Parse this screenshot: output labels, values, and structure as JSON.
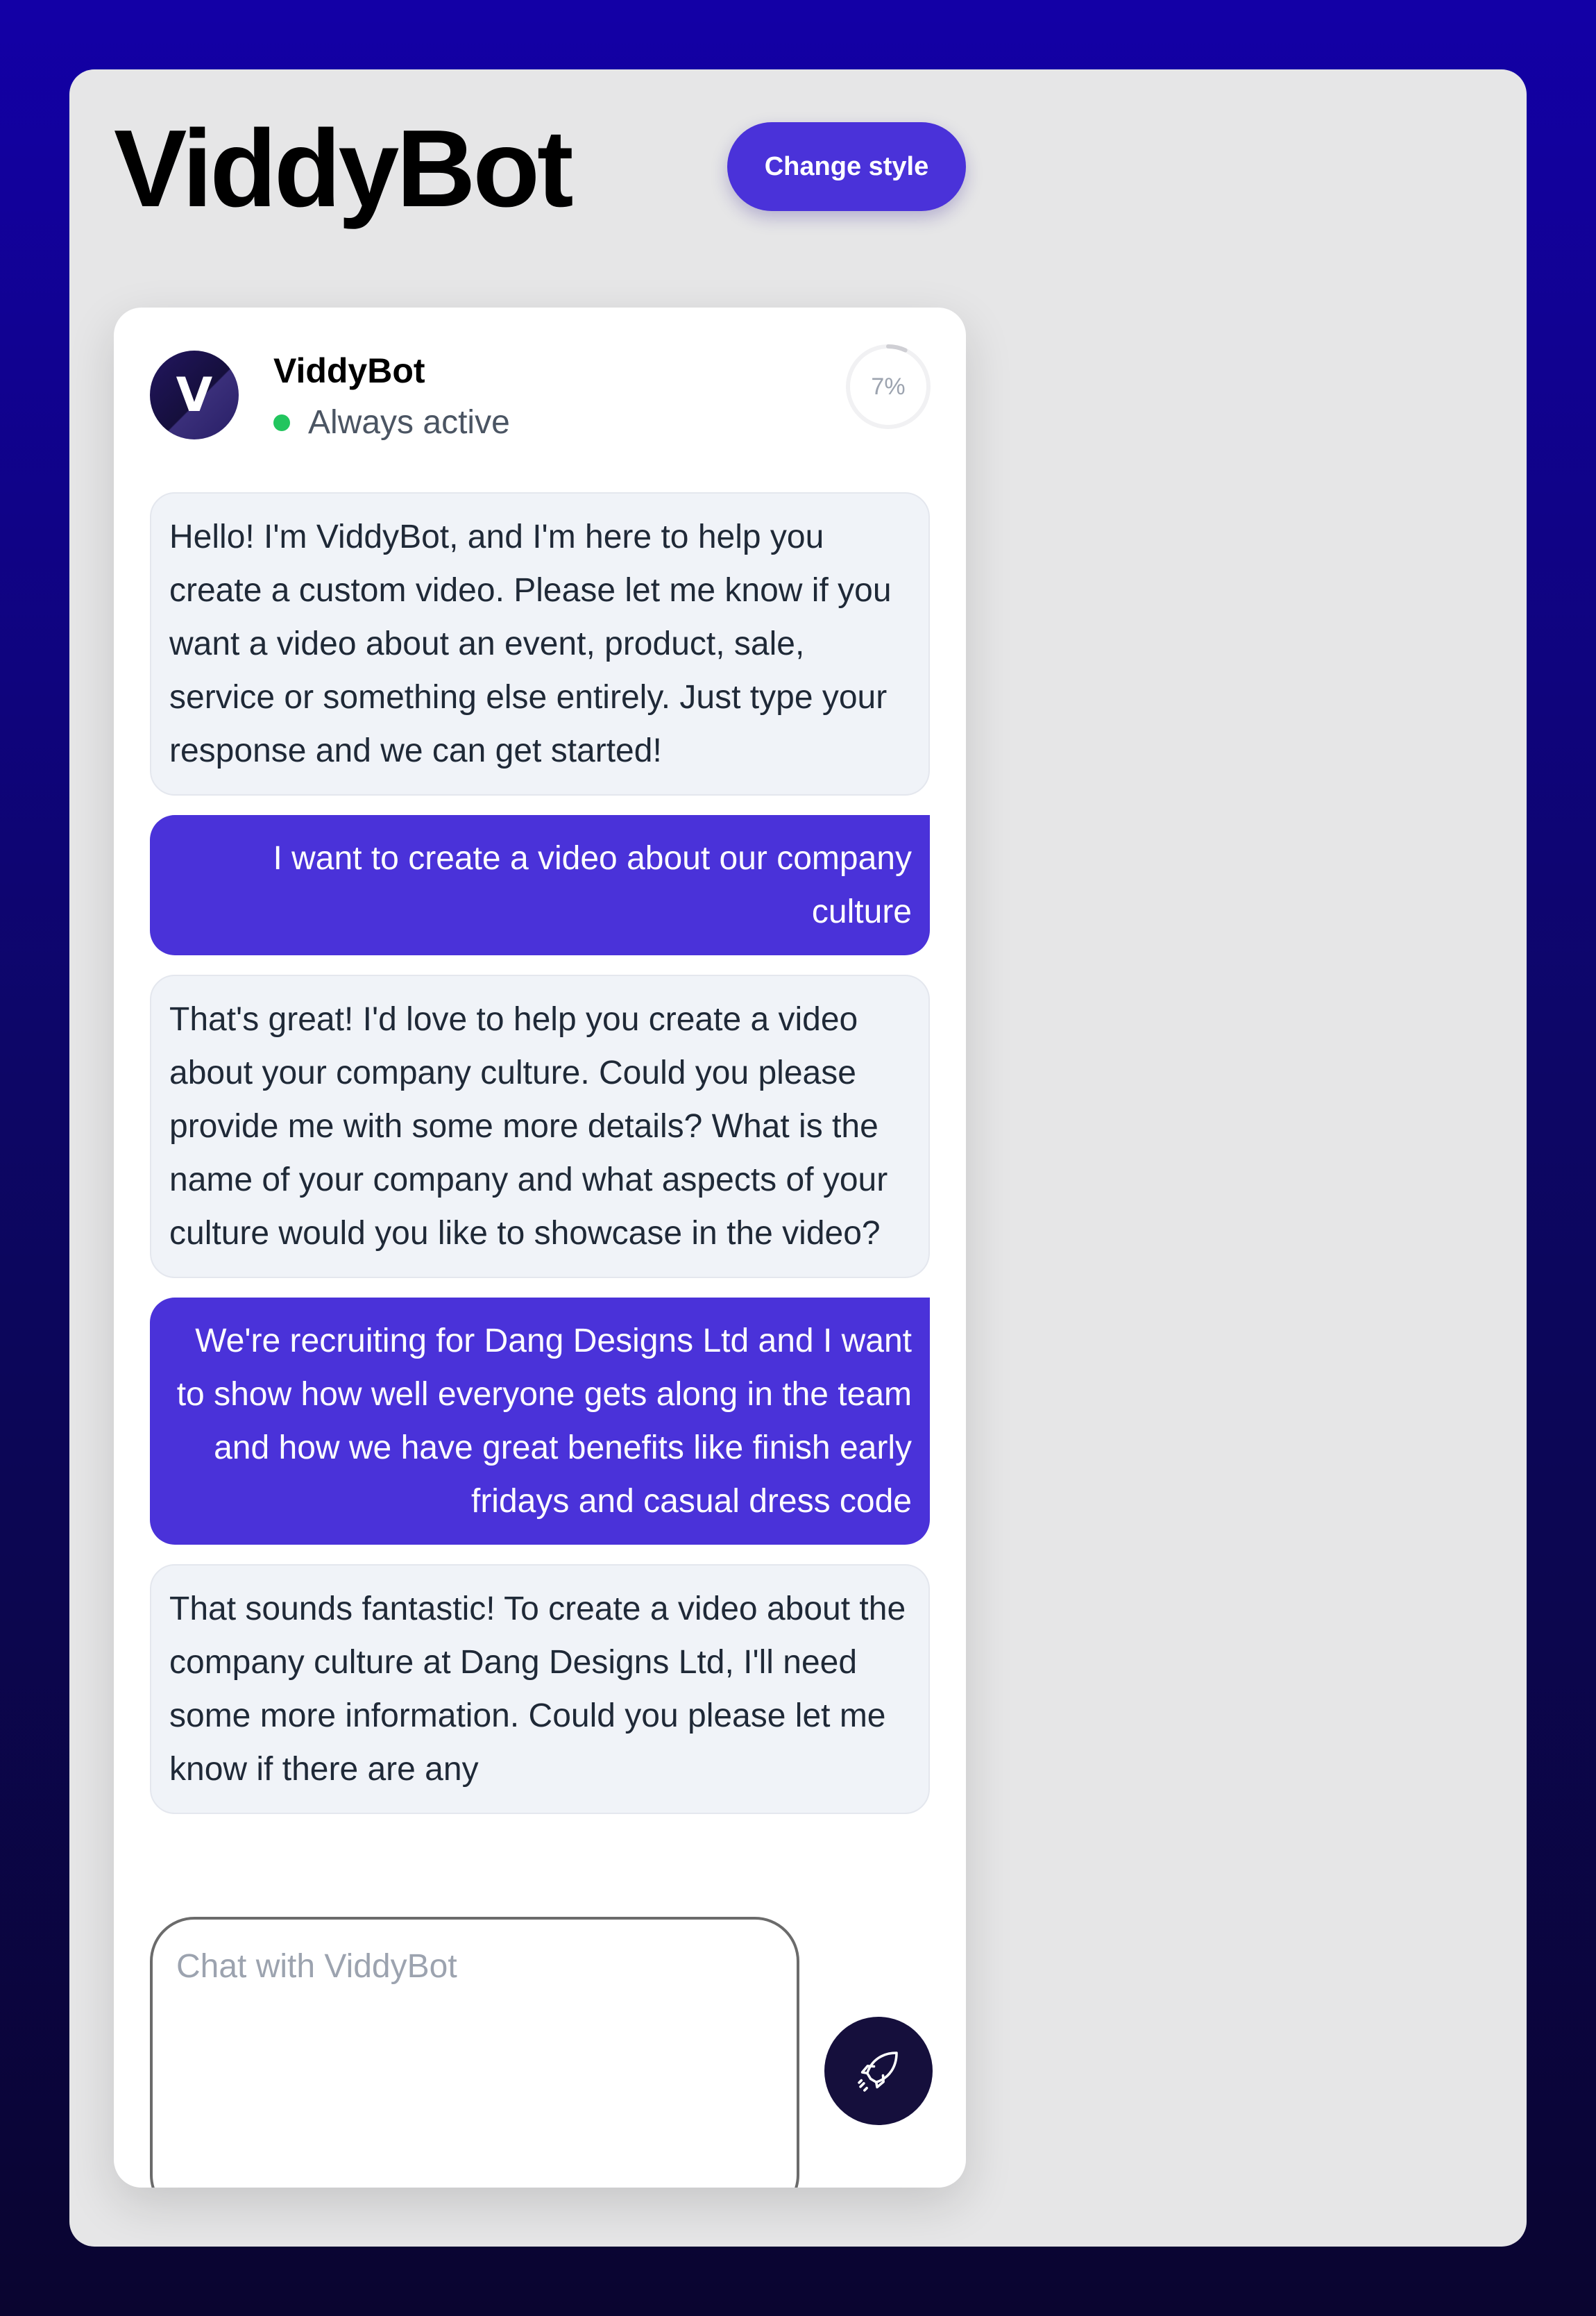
{
  "header": {
    "title": "ViddyBot",
    "change_style_label": "Change style"
  },
  "bot": {
    "avatar_letter": "V",
    "name": "ViddyBot",
    "status": "Always active",
    "status_color": "#22c55e"
  },
  "progress": {
    "value": 0.07,
    "label": "7%"
  },
  "messages": [
    {
      "role": "bot",
      "text": "Hello! I'm ViddyBot, and I'm here to help you create a custom video. Please let me know if you want a video about an event, product, sale, service or something else entirely. Just type your response and we can get started!"
    },
    {
      "role": "user",
      "text": "I want to create a video about our company culture"
    },
    {
      "role": "bot",
      "text": "That's great! I'd love to help you create a video about your company culture. Could you please provide me with some more details? What is the name of your company and what aspects of your culture would you like to showcase in the video?"
    },
    {
      "role": "user",
      "text": "We're recruiting for Dang Designs Ltd and I want to show how well everyone gets along in the team and how we have great benefits like finish early fridays and casual dress code"
    },
    {
      "role": "bot",
      "text": "That sounds fantastic! To create a video about the company culture at Dang Designs Ltd, I'll need some more information. Could you please let me know if there are any"
    }
  ],
  "composer": {
    "placeholder": "Chat with ViddyBot",
    "value": ""
  },
  "icons": {
    "send": "rocket-icon"
  },
  "colors": {
    "accent": "#4a32d9",
    "dark": "#150f3c",
    "bot_bubble": "#f0f3f8"
  }
}
